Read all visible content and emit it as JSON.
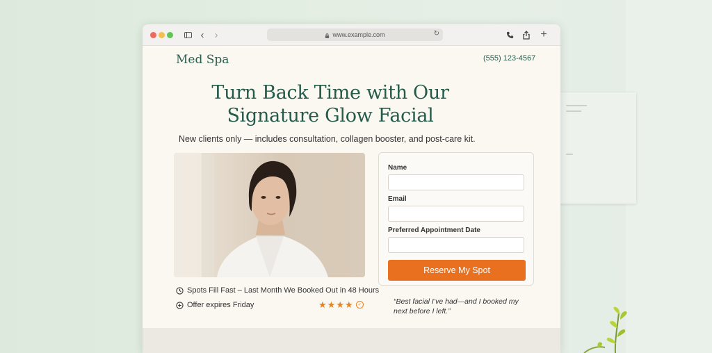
{
  "browser": {
    "url": "www.example.com",
    "icons": [
      "close-dot",
      "minimize-dot",
      "zoom-dot",
      "sidebar-icon",
      "back-icon",
      "forward-icon",
      "lock-icon",
      "reload-icon",
      "phone-icon",
      "share-icon",
      "new-tab-icon"
    ]
  },
  "header": {
    "brand": "Med Spa",
    "phone": "(555) 123-4567"
  },
  "hero": {
    "headline": "Turn Back Time with Our Signature Glow Facial",
    "subheadline": "New clients only — includes consultation, collagen booster, and post-care kit."
  },
  "form": {
    "name_label": "Name",
    "name_value": "",
    "email_label": "Email",
    "email_value": "",
    "date_label": "Preferred Appointment Date",
    "date_value": "",
    "submit_label": "Reserve My Spot"
  },
  "info": {
    "urgency": "Spots Fill Fast – Last Month We Booked Out in 48 Hours",
    "expiry": "Offer expires Friday"
  },
  "rating": {
    "stars_filled": 4,
    "stars_total": 4,
    "badge_icon": "verified-badge-icon"
  },
  "testimonial": {
    "quote": "“Best facial I’ve had—and I booked my next before I left.”"
  },
  "colors": {
    "brand_green": "#245b4b",
    "accent_orange": "#e8701f",
    "page_background": "#fbf8f2"
  }
}
